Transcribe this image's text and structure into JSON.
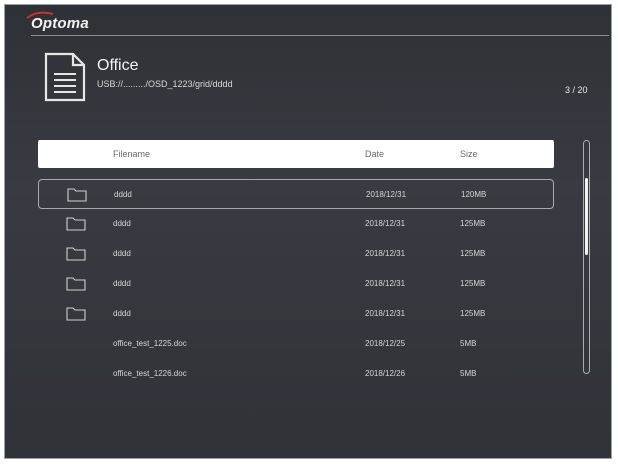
{
  "brand": {
    "logo_text": "Optoma"
  },
  "header": {
    "title": "Office",
    "path": "USB://........./OSD_1223/grid/dddd",
    "page_indicator": "3 / 20"
  },
  "table": {
    "columns": {
      "filename": "Filename",
      "date": "Date",
      "size": "Size"
    },
    "rows": [
      {
        "type": "folder",
        "name": "dddd",
        "date": "2018/12/31",
        "size": "120MB"
      },
      {
        "type": "folder",
        "name": "dddd",
        "date": "2018/12/31",
        "size": "125MB"
      },
      {
        "type": "folder",
        "name": "dddd",
        "date": "2018/12/31",
        "size": "125MB"
      },
      {
        "type": "folder",
        "name": "dddd",
        "date": "2018/12/31",
        "size": "125MB"
      },
      {
        "type": "folder",
        "name": "dddd",
        "date": "2018/12/31",
        "size": "125MB"
      },
      {
        "type": "file",
        "name": "office_test_1225.doc",
        "date": "2018/12/25",
        "size": "5MB"
      },
      {
        "type": "file",
        "name": "office_test_1226.doc",
        "date": "2018/12/26",
        "size": "5MB"
      }
    ],
    "selected_index": 0
  },
  "scrollbar": {
    "position_fraction": 0.16,
    "visible_fraction": 0.33
  },
  "colors": {
    "background": "#33363b",
    "header_row": "#ffffff",
    "logo_swoosh": "#c8322d"
  }
}
